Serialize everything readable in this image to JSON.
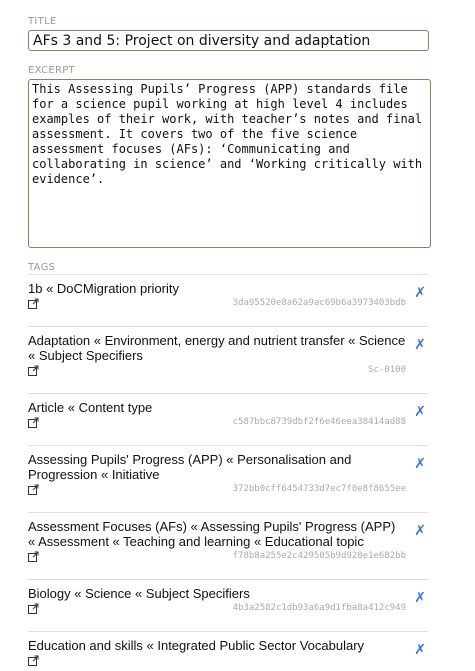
{
  "title_field": {
    "label": "TITLE",
    "value": "AFs 3 and 5: Project on diversity and adaptation"
  },
  "excerpt_field": {
    "label": "EXCERPT",
    "value": "This Assessing Pupils’ Progress (APP) standards file for a science pupil working at high level 4 includes examples of their work, with teacher’s notes and final assessment. It covers two of the five science assessment focuses (AFs): ‘Communicating and collaborating in science’ and ‘Working critically with evidence’."
  },
  "tags": {
    "label": "TAGS",
    "remove_icon": "✗",
    "items": [
      {
        "label": "1b « DoCMigration priority",
        "id": "3da95520e8a62a9ac69b6a3973403bdb"
      },
      {
        "label": "Adaptation « Environment, energy and nutrient transfer « Science « Subject Specifiers",
        "id": "Sc-0100"
      },
      {
        "label": "Article « Content type",
        "id": "c587bbc8739dbf2f6e46eea38414ad88"
      },
      {
        "label": "Assessing Pupils' Progress (APP) « Personalisation and Progression « Initiative",
        "id": "372bb0cff6454733d7ec7f0e8f8655ee"
      },
      {
        "label": "Assessment Focuses (AFs) « Assessing Pupils' Progress (APP) « Assessment « Teaching and learning « Educational topic",
        "id": "f78b8a255e2c429505b9d928e1e682bb"
      },
      {
        "label": "Biology « Science « Subject Specifiers",
        "id": "4b3a2582c1db93a6a9d1fba8a412c949"
      },
      {
        "label": "Education and skills « Integrated Public Sector Vocabulary",
        "id": ""
      }
    ]
  }
}
